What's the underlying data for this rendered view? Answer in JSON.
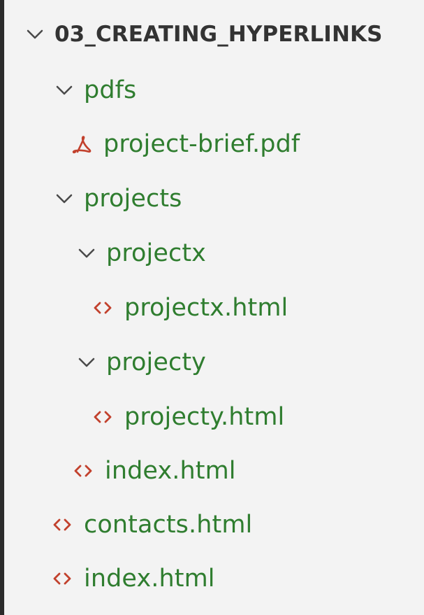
{
  "explorer": {
    "root_label": "03_CREATING_HYPERLINKS",
    "items": [
      {
        "label": "pdfs"
      },
      {
        "label": "project-brief.pdf"
      },
      {
        "label": "projects"
      },
      {
        "label": "projectx"
      },
      {
        "label": "projectx.html"
      },
      {
        "label": "projecty"
      },
      {
        "label": "projecty.html"
      },
      {
        "label": "index.html"
      },
      {
        "label": "contacts.html"
      },
      {
        "label": "index.html"
      }
    ]
  },
  "colors": {
    "background": "#f3f3f3",
    "label_green": "#2f7d2f",
    "pdf_red": "#c2412d",
    "code_icon": "#c2412d",
    "chevron_gray": "#4a4a4a",
    "left_border": "#2b2b2b"
  },
  "icons": {
    "chevron": "chevron-down-icon",
    "pdf": "pdf-icon",
    "html": "html-code-icon"
  }
}
